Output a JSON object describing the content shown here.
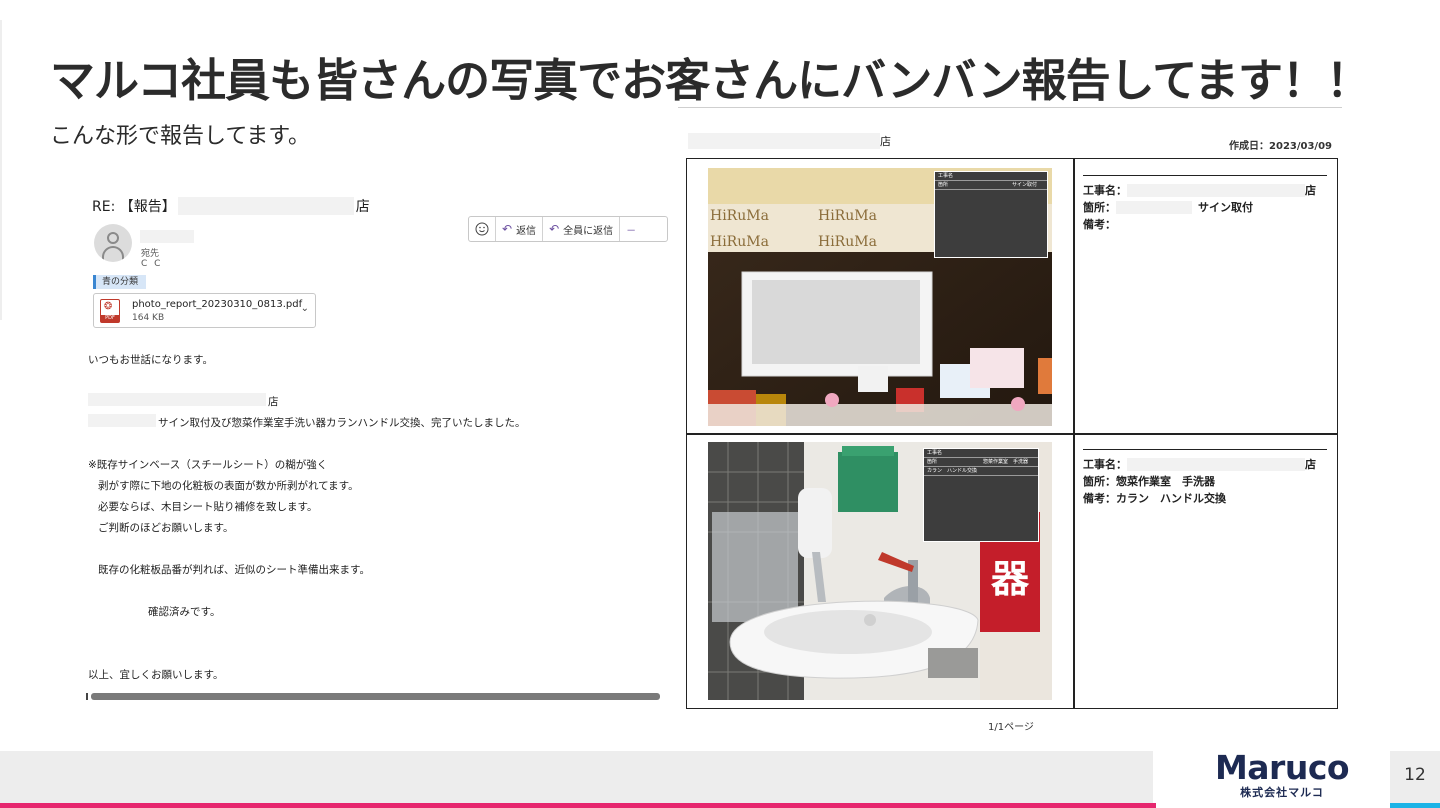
{
  "slide": {
    "title": "マルコ社員も皆さんの写真でお客さんにバンバン報告してます！！",
    "subtitle": "こんな形で報告してます。",
    "page_number": "12"
  },
  "email": {
    "subject_prefix": "RE: 【報告】",
    "subject_suffix": "店",
    "toolbar": {
      "emoji_icon": "smiley-icon",
      "reply": "返信",
      "reply_all": "全員に返信",
      "more": "－"
    },
    "to_label": "宛先",
    "cc_label": "C C",
    "category": "青の分類",
    "attachment": {
      "name": "photo_report_20230310_0813.pdf",
      "size": "164 KB",
      "icon_label": "PDF"
    },
    "body": {
      "greeting": "いつもお世話になります。",
      "store_suffix": "店",
      "work_line": "サイン取付及び惣菜作業室手洗い器カランハンドル交換、完了いたしました。",
      "note_1": "※既存サインベース（スチールシート）の糊が強く",
      "note_2": "剥がす際に下地の化粧板の表面が数か所剥がれてます。",
      "note_3": "必要ならば、木目シート貼り補修を致します。",
      "note_4": "ご判断のほどお願いします。",
      "note_5": "既存の化粧板品番が判れば、近似のシート準備出来ます。",
      "note_6": "確認済みです。",
      "closing": "以上、宜しくお願いします。"
    }
  },
  "report": {
    "store_suffix": "店",
    "created_date": "作成日：2023/03/09",
    "page_indicator": "1/1ページ",
    "entries": [
      {
        "project_label": "工事名：",
        "project_suffix": "店",
        "location_label": "箇所：",
        "location_value": "サイン取付",
        "remarks_label": "備考：",
        "remarks_value": "",
        "board": {
          "r1": "工事名",
          "r2k": "箇所",
          "r2v": "サイン取付"
        }
      },
      {
        "project_label": "工事名：",
        "project_suffix": "店",
        "location_label": "箇所：",
        "location_value": "惣菜作業室　手洗器",
        "remarks_label": "備考：",
        "remarks_value": "カラン　ハンドル交換",
        "board": {
          "r1": "工事名",
          "r2k": "箇所",
          "r2v": "惣菜作業室　手洗器",
          "r3": "カラン　ハンドル交換"
        }
      }
    ],
    "banner_text": "HiRuMa",
    "sign_glyph": "器"
  },
  "footer": {
    "logo_main": "Maruco",
    "logo_sub": "株式会社マルコ"
  },
  "colors": {
    "accent_pink": "#e6266e",
    "accent_blue": "#1bb3e6",
    "logo_navy": "#1d2a52"
  }
}
